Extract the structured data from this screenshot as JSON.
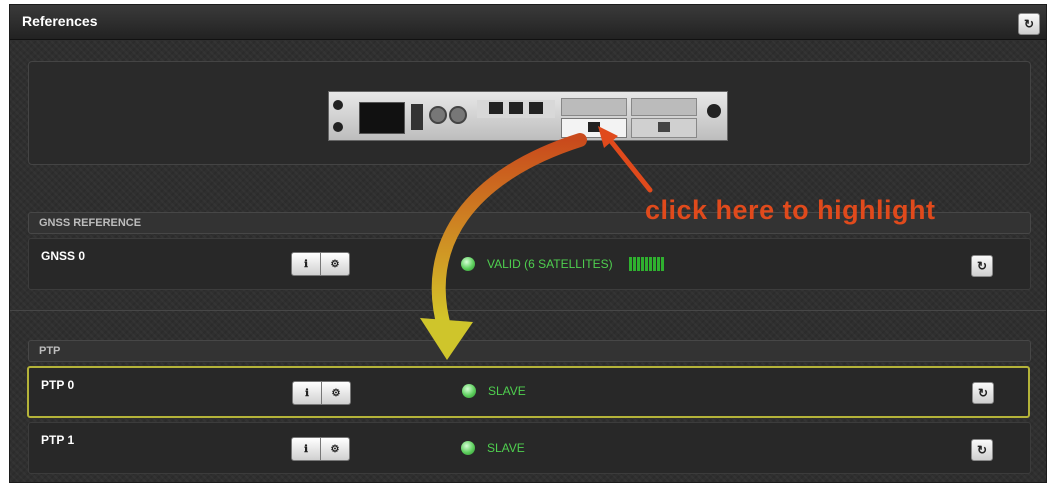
{
  "panel": {
    "title": "References",
    "refresh_icon": "refresh-icon"
  },
  "sections": [
    {
      "header": "GNSS REFERENCE",
      "rows": [
        {
          "label": "GNSS 0",
          "status": "VALID (6 SATELLITES)",
          "signal_bars": 6,
          "highlighted": false
        }
      ]
    },
    {
      "header": "PTP",
      "rows": [
        {
          "label": "PTP 0",
          "status": "SLAVE",
          "highlighted": true
        },
        {
          "label": "PTP 1",
          "status": "SLAVE",
          "highlighted": false
        }
      ]
    }
  ],
  "annotation": {
    "text": "click here to highlight",
    "color": "#e04a1c"
  },
  "colors": {
    "led": "#5cce5c",
    "status_text": "#4fcf4f",
    "highlight_border": "#b4b339"
  },
  "icons": {
    "info": "info-icon",
    "settings": "gear-icon",
    "refresh": "refresh-icon"
  }
}
